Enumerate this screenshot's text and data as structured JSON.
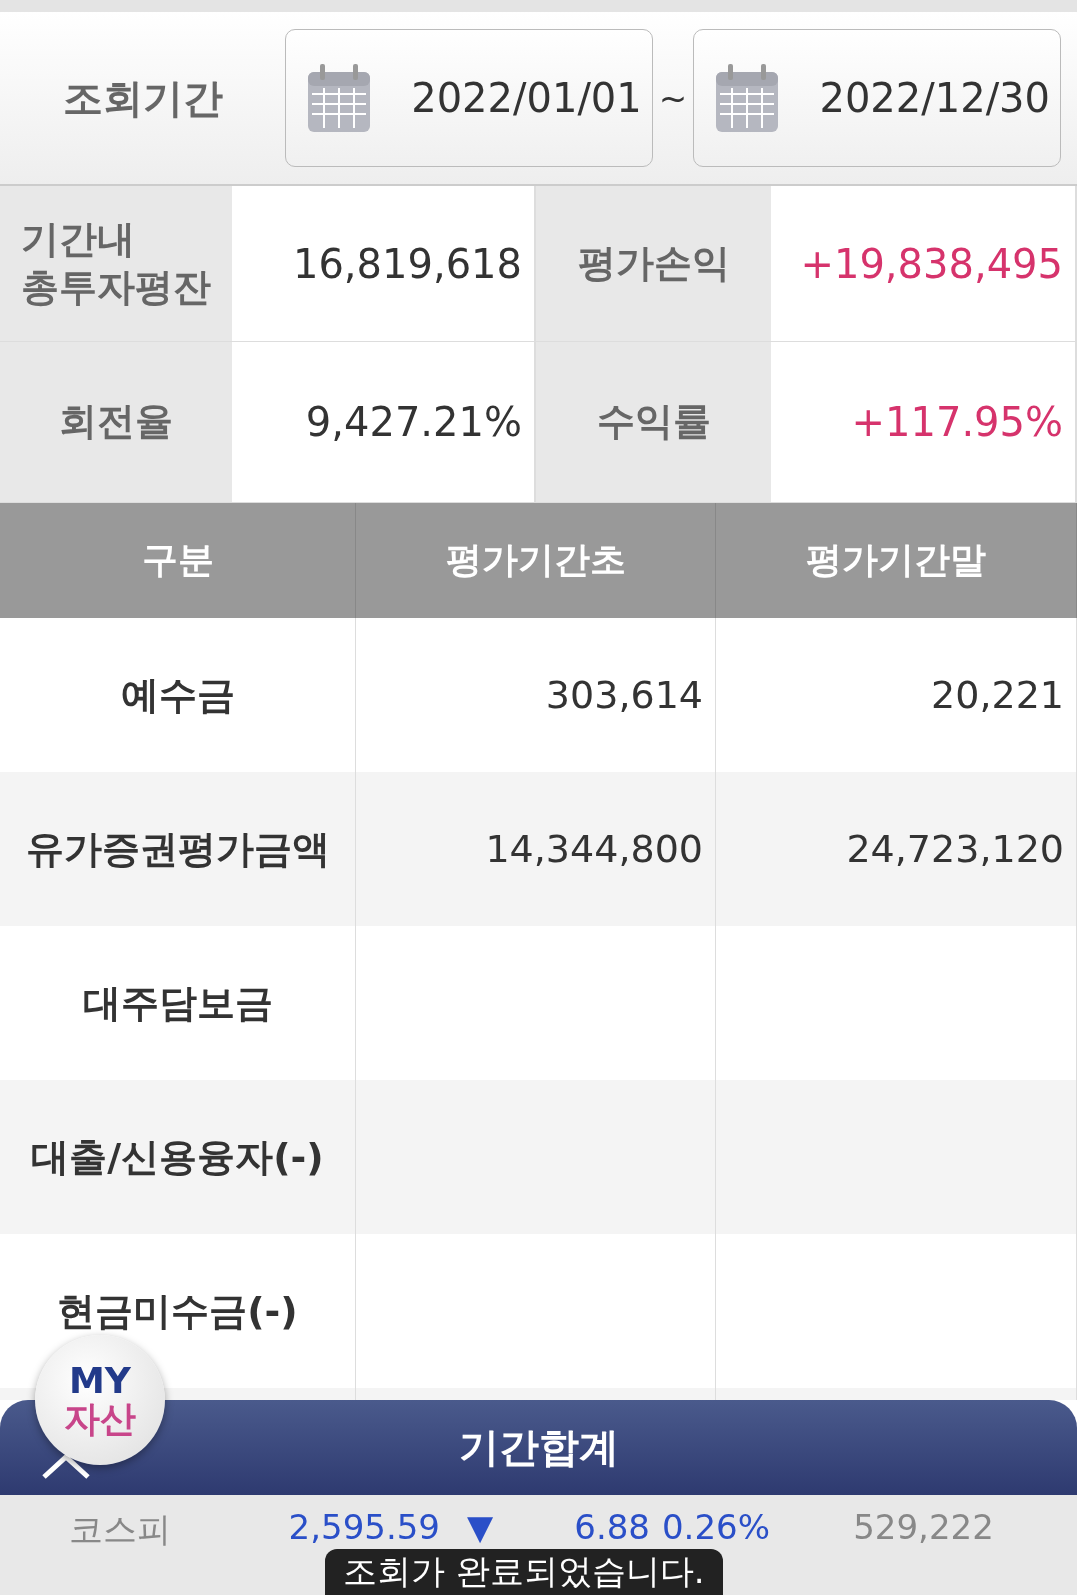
{
  "period": {
    "label": "조회기간",
    "start": "2022/01/01",
    "separator": "~",
    "end": "2022/12/30"
  },
  "summary": [
    {
      "label": "기간내\n총투자평잔",
      "value": "16,819,618",
      "positive": false,
      "label2": "평가손익",
      "value2": "+19,838,495",
      "positive2": true
    },
    {
      "label": "회전율",
      "value": "9,427.21%",
      "positive": false,
      "label2": "수익률",
      "value2": "+117.95%",
      "positive2": true
    }
  ],
  "table": {
    "columns": [
      "구분",
      "평가기간초",
      "평가기간말"
    ],
    "rows": [
      {
        "label": "예수금",
        "start": "303,614",
        "end": "20,221"
      },
      {
        "label": "유가증권평가금액",
        "start": "14,344,800",
        "end": "24,723,120"
      },
      {
        "label": "대주담보금",
        "start": "",
        "end": ""
      },
      {
        "label": "대출/신용융자(-)",
        "start": "",
        "end": ""
      },
      {
        "label": "현금미수금(-)",
        "start": "",
        "end": ""
      }
    ]
  },
  "float_button": {
    "line1": "MY",
    "line2": "자산"
  },
  "footer": {
    "title": "기간합계",
    "expanded": false
  },
  "ticker": {
    "name": "코스피",
    "index": "2,595.59",
    "arrow": "▼",
    "change": "6.88",
    "rate": "0.26%",
    "volume": "529,222"
  },
  "toast": "조회가 완료되었습니다."
}
